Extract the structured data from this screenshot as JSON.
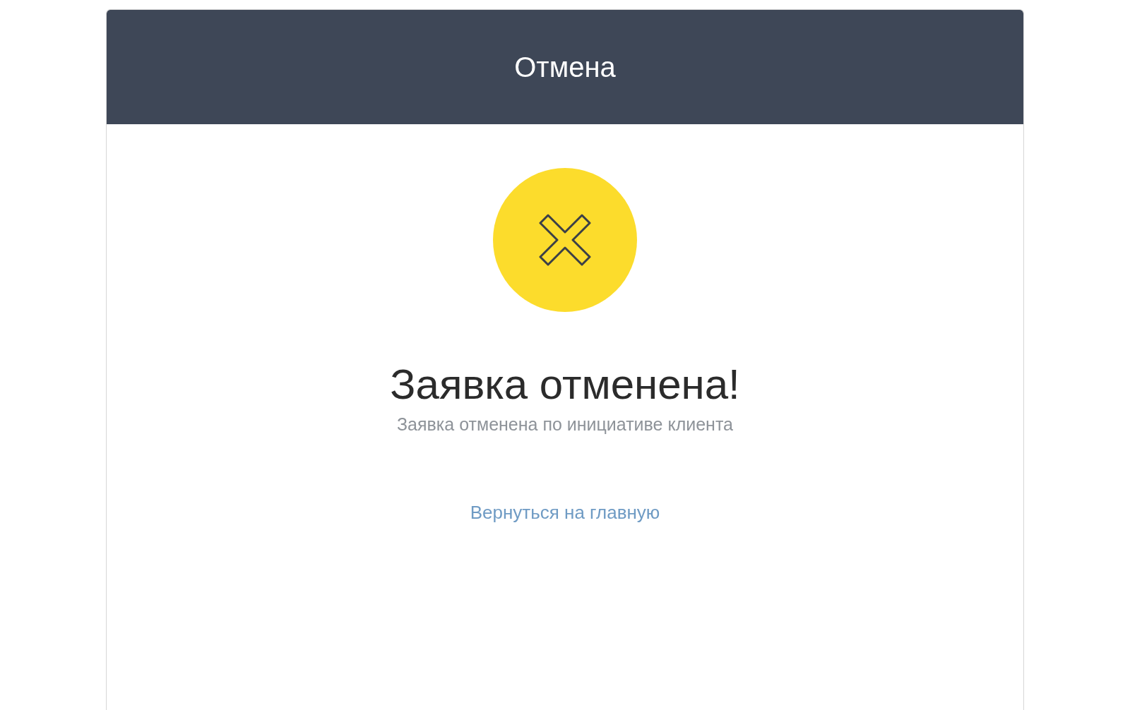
{
  "header": {
    "title": "Отмена"
  },
  "status": {
    "kind": "cancelled",
    "title": "Заявка отменена!",
    "message": "Заявка отменена по инициативе клиента"
  },
  "link": {
    "label": "Вернуться на главную"
  }
}
